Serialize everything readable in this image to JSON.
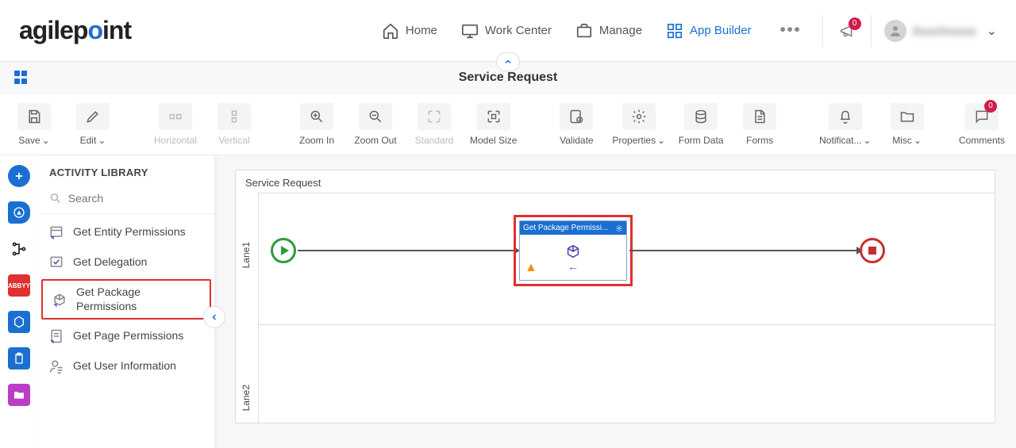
{
  "nav": {
    "home": "Home",
    "work_center": "Work Center",
    "manage": "Manage",
    "app_builder": "App Builder",
    "notifications_count": "0",
    "username": "XxxxXxxxxx"
  },
  "titlebar": {
    "title": "Service Request"
  },
  "toolbar": {
    "save": "Save",
    "edit": "Edit",
    "horizontal": "Horizontal",
    "vertical": "Vertical",
    "zoom_in": "Zoom In",
    "zoom_out": "Zoom Out",
    "standard": "Standard",
    "model_size": "Model Size",
    "validate": "Validate",
    "properties": "Properties",
    "form_data": "Form Data",
    "forms": "Forms",
    "notifications": "Notificat...",
    "misc": "Misc",
    "comments": "Comments",
    "comments_count": "0"
  },
  "sidebar": {
    "header": "ACTIVITY LIBRARY",
    "search_placeholder": "Search",
    "items": [
      {
        "label": "Get Entity Permissions"
      },
      {
        "label": "Get Delegation"
      },
      {
        "label": "Get Package Permissions"
      },
      {
        "label": "Get Page Permissions"
      },
      {
        "label": "Get User Information"
      }
    ]
  },
  "rail": {
    "abbyy": "ABBYY"
  },
  "canvas": {
    "title": "Service Request",
    "lane1": "Lane1",
    "lane2": "Lane2",
    "activity_label": "Get Package Permissi..."
  }
}
